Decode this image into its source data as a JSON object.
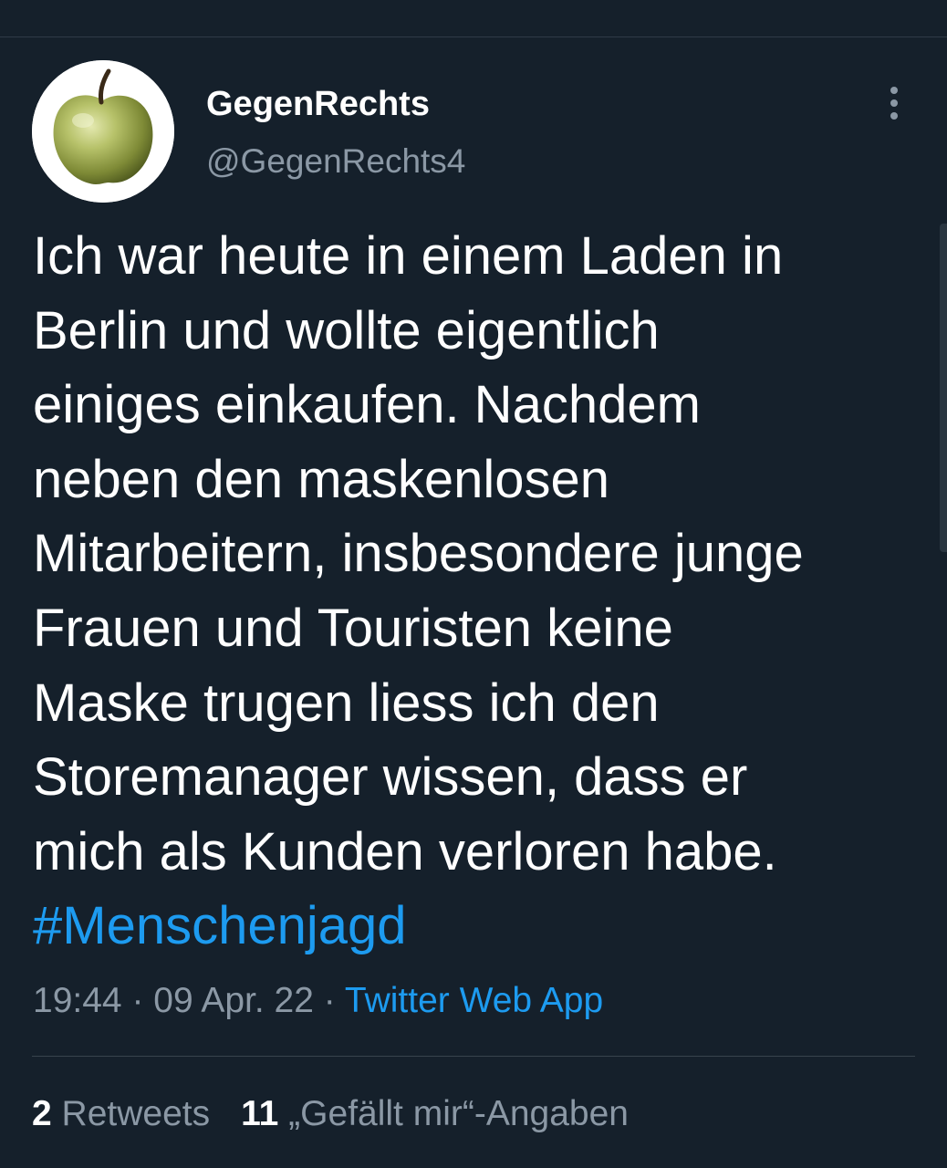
{
  "colors": {
    "background": "#15202b",
    "text_primary": "#ffffff",
    "text_secondary": "#8b98a5",
    "accent": "#1d9bf0",
    "divider": "#38444d"
  },
  "author": {
    "display_name": "GegenRechts",
    "handle": "@GegenRechts4",
    "avatar_icon": "green-apple-avatar"
  },
  "menu": {
    "icon": "more-vertical-icon"
  },
  "tweet": {
    "lines": [
      "Ich war heute in einem Laden in",
      "Berlin und wollte eigentlich",
      "einiges einkaufen. Nachdem",
      "neben den maskenlosen",
      "Mitarbeitern, insbesondere junge",
      "Frauen und Touristen keine",
      "Maske trugen liess ich den",
      "Storemanager wissen, dass er",
      "mich als Kunden verloren habe."
    ],
    "hashtag": "#Menschenjagd"
  },
  "meta": {
    "time": "19:44",
    "separator": " · ",
    "date": "09 Apr. 22",
    "source": "Twitter Web App"
  },
  "stats": {
    "retweets_count": "2",
    "retweets_label": " Retweets",
    "likes_count": "11",
    "likes_label": " „Gefällt mir“-Angaben"
  }
}
